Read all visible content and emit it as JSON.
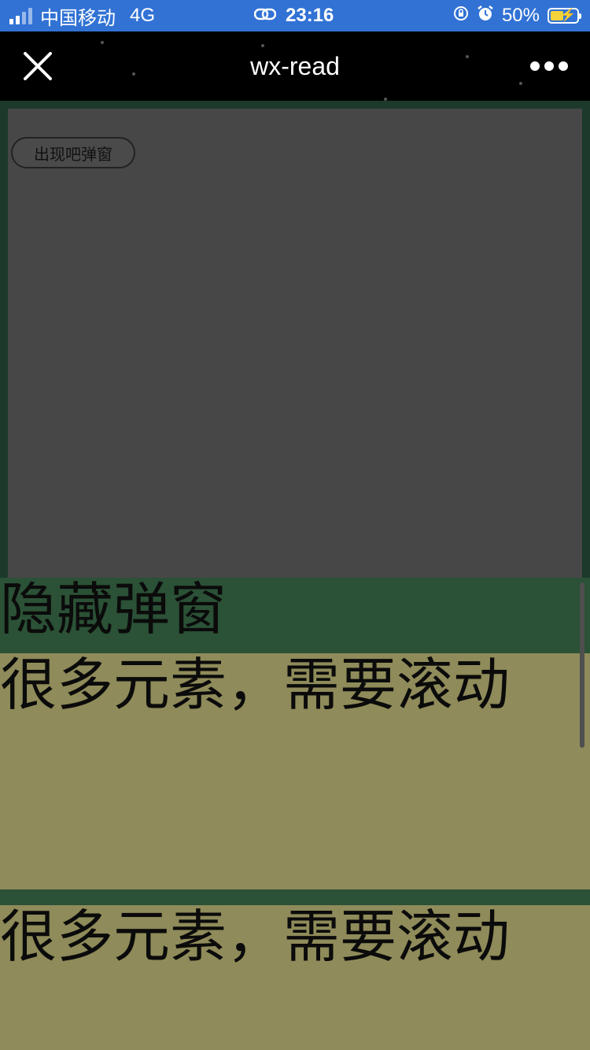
{
  "status_bar": {
    "carrier": "中国移动",
    "network": "4G",
    "time": "23:16",
    "battery_percent": "50%",
    "battery_level": 0.5
  },
  "nav": {
    "title": "wx-read"
  },
  "main": {
    "popup_button_label": "出现吧弹窗",
    "hide_popup_label": "隐藏弹窗",
    "items": [
      {
        "text": "很多元素，需要滚动"
      },
      {
        "text": "很多元素，需要滚动"
      }
    ]
  },
  "colors": {
    "status_bar_bg": "#3172d4",
    "nav_bg": "#000000",
    "frame_bg": "#1c3a2b",
    "panel_bg": "#474747",
    "hide_bar_bg": "#2b5136",
    "item_bg": "#8f8b5a"
  }
}
